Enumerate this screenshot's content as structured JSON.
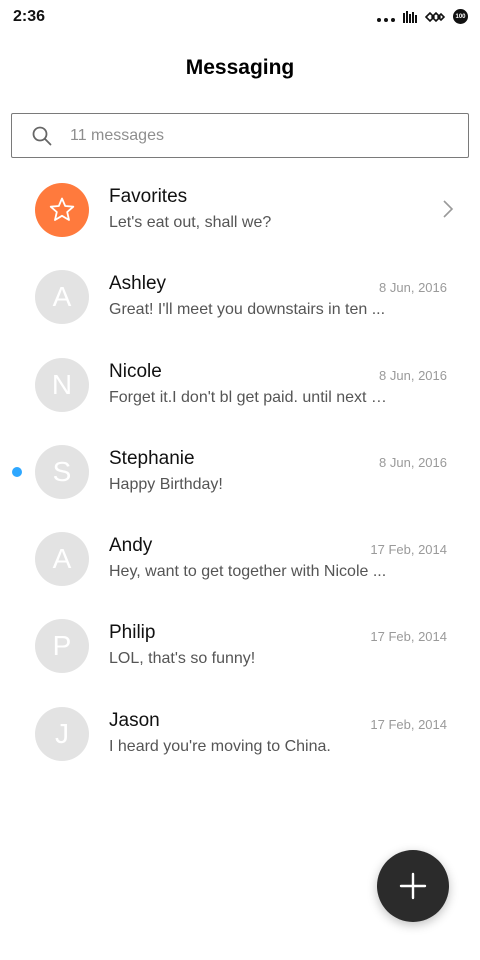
{
  "status_bar": {
    "time": "2:36",
    "battery_label": "100",
    "icons": [
      "more-dots-icon",
      "signal-icon",
      "wifi-icon",
      "battery-icon"
    ]
  },
  "header": {
    "title": "Messaging"
  },
  "search": {
    "placeholder": "11 messages",
    "value": ""
  },
  "conversations": [
    {
      "name": "Favorites",
      "preview": "Let's eat out, shall we?",
      "date": "",
      "initial": "",
      "type": "favorites",
      "unread": false
    },
    {
      "name": "Ashley",
      "preview": "Great! I'll meet you downstairs in ten ...",
      "date": "8 Jun, 2016",
      "initial": "A",
      "unread": false
    },
    {
      "name": "Nicole",
      "preview": "Forget it.I don't bl get paid. until next F...",
      "date": "8 Jun, 2016",
      "initial": "N",
      "unread": false
    },
    {
      "name": "Stephanie",
      "preview": "Happy Birthday!",
      "date": "8 Jun, 2016",
      "initial": "S",
      "unread": true
    },
    {
      "name": "Andy",
      "preview": "Hey, want to get together with Nicole ...",
      "date": "17 Feb, 2014",
      "initial": "A",
      "unread": false
    },
    {
      "name": "Philip",
      "preview": "LOL, that's so funny!",
      "date": "17 Feb, 2014",
      "initial": "P",
      "unread": false
    },
    {
      "name": "Jason",
      "preview": "I heard you're moving to China.",
      "date": "17 Feb, 2014",
      "initial": "J",
      "unread": false
    }
  ],
  "colors": {
    "favorites_avatar": "#ff7a3d",
    "avatar_gray": "#e3e3e3",
    "unread_dot": "#2ea7ff",
    "fab": "#2b2b2b"
  },
  "fab": {
    "icon": "plus-icon"
  }
}
